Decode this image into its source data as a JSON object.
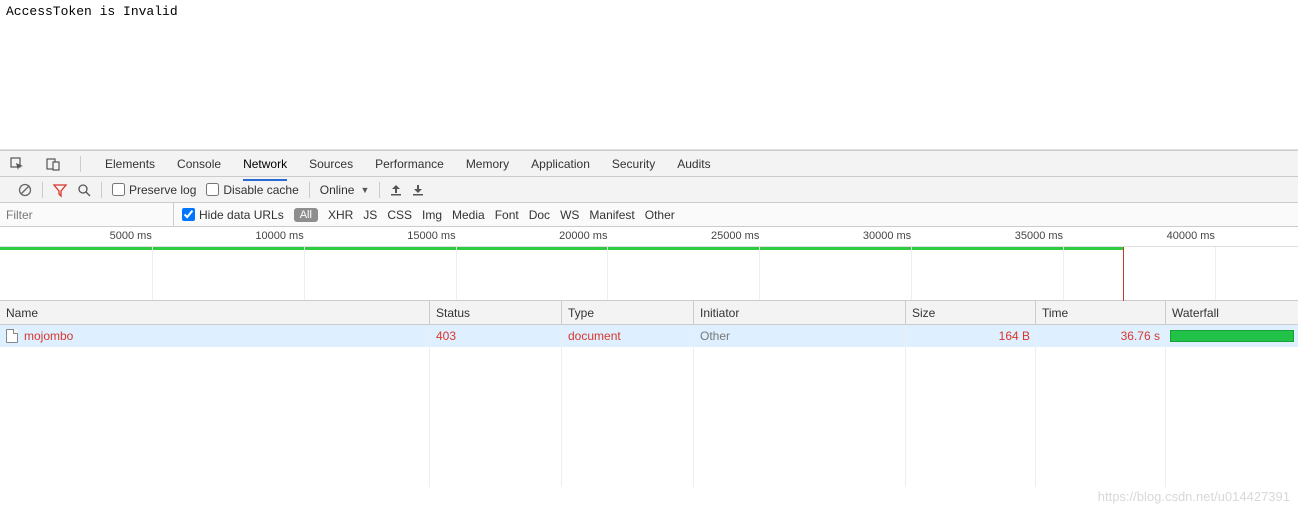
{
  "page": {
    "message": "AccessToken is Invalid"
  },
  "tabs": {
    "items": [
      "Elements",
      "Console",
      "Network",
      "Sources",
      "Performance",
      "Memory",
      "Application",
      "Security",
      "Audits"
    ],
    "active": "Network"
  },
  "toolbar": {
    "preserve_log_label": "Preserve log",
    "disable_cache_label": "Disable cache",
    "throttling": "Online"
  },
  "filter": {
    "placeholder": "Filter",
    "hide_data_urls_label": "Hide data URLs",
    "all_label": "All",
    "types": [
      "XHR",
      "JS",
      "CSS",
      "Img",
      "Media",
      "Font",
      "Doc",
      "WS",
      "Manifest",
      "Other"
    ]
  },
  "timeline": {
    "labels": [
      "5000 ms",
      "10000 ms",
      "15000 ms",
      "20000 ms",
      "25000 ms",
      "30000 ms",
      "35000 ms",
      "40000 ms"
    ]
  },
  "columns": {
    "name": "Name",
    "status": "Status",
    "type": "Type",
    "initiator": "Initiator",
    "size": "Size",
    "time": "Time",
    "waterfall": "Waterfall"
  },
  "requests": [
    {
      "name": "mojombo",
      "status": "403",
      "type": "document",
      "initiator": "Other",
      "size": "164 B",
      "time": "36.76 s",
      "error": true
    }
  ],
  "watermark": "https://blog.csdn.net/u014427391"
}
